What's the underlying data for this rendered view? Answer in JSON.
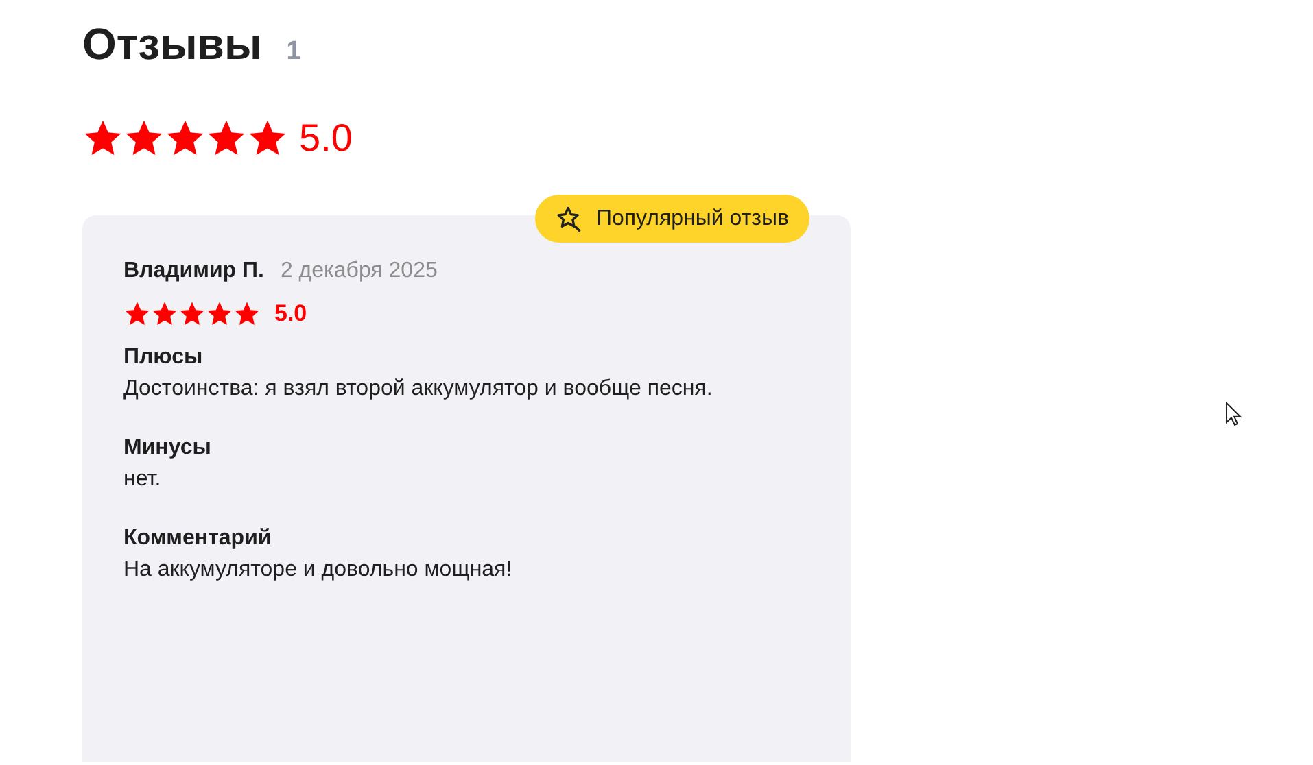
{
  "title": "Отзывы",
  "count": "1",
  "summary": {
    "stars": 5,
    "rating": "5.0"
  },
  "review": {
    "badge": "Популярный отзыв",
    "author": "Владимир П.",
    "date": "2 декабря 2025",
    "stars": 5,
    "rating": "5.0",
    "sections": [
      {
        "title": "Плюсы",
        "text": "Достоинства: я взял второй аккумулятор и вообще песня."
      },
      {
        "title": "Минусы",
        "text": "нет."
      },
      {
        "title": "Комментарий",
        "text": "На аккумуляторе и довольно мощная!"
      }
    ]
  }
}
